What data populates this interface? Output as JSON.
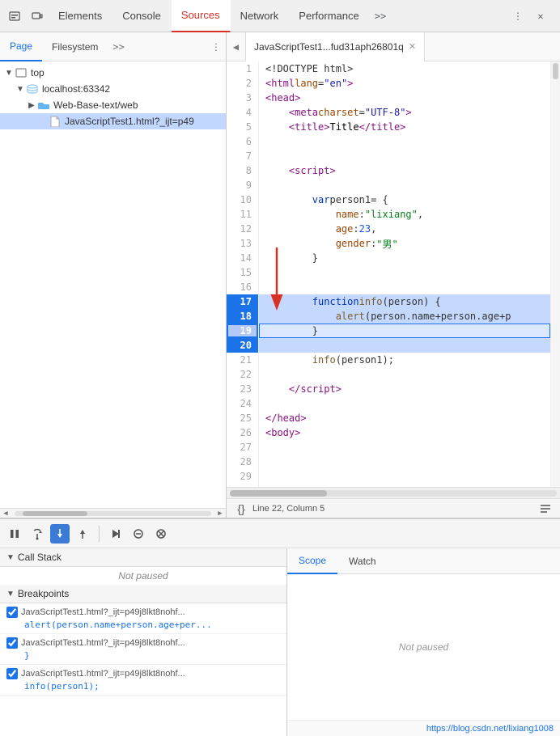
{
  "tabs": {
    "items": [
      {
        "label": "Elements",
        "active": false
      },
      {
        "label": "Console",
        "active": false
      },
      {
        "label": "Sources",
        "active": true
      },
      {
        "label": "Network",
        "active": false
      },
      {
        "label": "Performance",
        "active": false
      }
    ],
    "more": ">>"
  },
  "left": {
    "tabs": [
      "Page",
      "Filesystem"
    ],
    "more": ">>",
    "tree": [
      {
        "indent": 0,
        "arrow": "▼",
        "icon": "folder",
        "label": "top",
        "selected": false
      },
      {
        "indent": 1,
        "arrow": "▼",
        "icon": "server",
        "label": "localhost:63342",
        "selected": false
      },
      {
        "indent": 2,
        "arrow": "▶",
        "icon": "folder",
        "label": "Web-Base-text/web",
        "selected": false
      },
      {
        "indent": 3,
        "arrow": "",
        "icon": "file",
        "label": "JavaScriptTest1.html?_ijt=p49",
        "selected": true
      }
    ]
  },
  "editor": {
    "tab_label": "JavaScriptTest1...fud31aph26801q",
    "lines": [
      {
        "num": 1,
        "code": "&lt;!DOCTYPE html&gt;",
        "type": "tag"
      },
      {
        "num": 2,
        "code": "&lt;html lang=&quot;en&quot;&gt;",
        "type": "tag"
      },
      {
        "num": 3,
        "code": "&lt;head&gt;",
        "type": "tag"
      },
      {
        "num": 4,
        "code": "    &lt;meta charset=&quot;UTF-8&quot;&gt;",
        "type": "tag"
      },
      {
        "num": 5,
        "code": "    &lt;title&gt;Title&lt;/title&gt;",
        "type": "tag"
      },
      {
        "num": 6,
        "code": "",
        "type": "empty"
      },
      {
        "num": 7,
        "code": "",
        "type": "empty"
      },
      {
        "num": 8,
        "code": "    &lt;script&gt;",
        "type": "tag"
      },
      {
        "num": 9,
        "code": "",
        "type": "empty"
      },
      {
        "num": 10,
        "code": "        var person1 = {",
        "type": "js"
      },
      {
        "num": 11,
        "code": "            name:&quot;lixiang&quot;,",
        "type": "js"
      },
      {
        "num": 12,
        "code": "            age:23,",
        "type": "js"
      },
      {
        "num": 13,
        "code": "            gender:&quot;男&quot;",
        "type": "js"
      },
      {
        "num": 14,
        "code": "        }",
        "type": "js"
      },
      {
        "num": 15,
        "code": "",
        "type": "empty"
      },
      {
        "num": 16,
        "code": "",
        "type": "empty",
        "breakpoint_box": true
      },
      {
        "num": 17,
        "code": "        function info(person) {",
        "type": "js",
        "breakpoint": true
      },
      {
        "num": 18,
        "code": "            alert(person.name+person.age+p",
        "type": "js",
        "breakpoint": true
      },
      {
        "num": 19,
        "code": "        }",
        "type": "js",
        "breakpoint_outline": true
      },
      {
        "num": 20,
        "code": "",
        "type": "empty",
        "breakpoint": true
      },
      {
        "num": 21,
        "code": "        info(person1);",
        "type": "js"
      },
      {
        "num": 22,
        "code": "",
        "type": "empty"
      },
      {
        "num": 23,
        "code": "    &lt;/script&gt;",
        "type": "tag"
      },
      {
        "num": 24,
        "code": "",
        "type": "empty"
      },
      {
        "num": 25,
        "code": "&lt;/head&gt;",
        "type": "tag"
      },
      {
        "num": 26,
        "code": "&lt;body&gt;",
        "type": "tag"
      },
      {
        "num": 27,
        "code": "",
        "type": "empty"
      },
      {
        "num": 28,
        "code": "",
        "type": "empty"
      },
      {
        "num": 29,
        "code": "",
        "type": "empty"
      }
    ],
    "status": "Line 22, Column 5"
  },
  "debug": {
    "toolbar_buttons": [
      "pause",
      "step-over",
      "step-into",
      "step-out",
      "resume",
      "deactivate",
      "stop"
    ],
    "call_stack_header": "Call Stack",
    "call_stack_status": "Not paused",
    "breakpoints_header": "Breakpoints",
    "breakpoints": [
      {
        "filename": "JavaScriptTest1.html?_ijt=p49j8lkt8nohf...",
        "code": "alert(person.name+person.age+per..."
      },
      {
        "filename": "JavaScriptTest1.html?_ijt=p49j8lkt8nohf...",
        "code": "}"
      },
      {
        "filename": "JavaScriptTest1.html?_ijt=p49j8lkt8nohf...",
        "code": "info(person1);"
      }
    ],
    "scope_tab": "Scope",
    "watch_tab": "Watch",
    "not_paused": "Not paused",
    "url": "https://blog.csdn.net/lixiang1008"
  }
}
